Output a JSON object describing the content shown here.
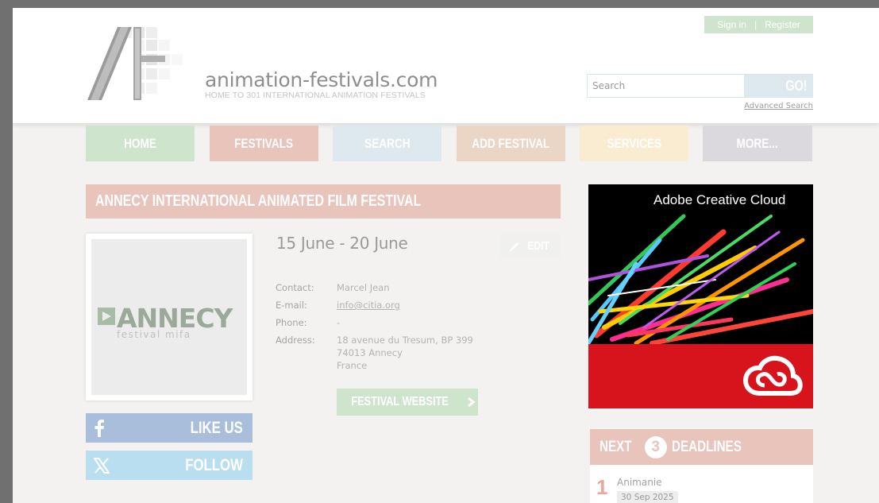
{
  "header": {
    "site_name": "animation-festivals.com",
    "tagline": "HOME TO 301 INTERNATIONAL ANIMATION FESTIVALS",
    "sign_in": "Sign in",
    "separator": "|",
    "register": "Register",
    "search_placeholder": "Search",
    "search_button": "GO!",
    "advanced_search": "Advanced Search"
  },
  "nav": [
    {
      "label": "HOME",
      "color": "#cfe4cd"
    },
    {
      "label": "FESTIVALS",
      "color": "#e8c4bb"
    },
    {
      "label": "SEARCH",
      "color": "#dde9ee"
    },
    {
      "label": "ADD FESTIVAL",
      "color": "#ebd5c4"
    },
    {
      "label": "SERVICES",
      "color": "#faecd1"
    },
    {
      "label": "MORE...",
      "color": "#dcd9de"
    }
  ],
  "festival": {
    "title": "ANNECY INTERNATIONAL ANIMATED FILM FESTIVAL",
    "logo_text": "ANNECY",
    "logo_subtext": "festival mifa",
    "dates": "15 June - 20 June",
    "edit_label": "EDIT",
    "contact_label": "Contact:",
    "contact_value": "Marcel Jean",
    "email_label": "E-mail:",
    "email_value": "info@citia.org",
    "phone_label": "Phone:",
    "phone_value": "-",
    "address_label": "Address:",
    "address_line1": "18 avenue du Tresum, BP 399",
    "address_line2": "74013 Annecy",
    "address_line3": "France",
    "website_label": "FESTIVAL WEBSITE"
  },
  "social": {
    "facebook_label": "LIKE US",
    "x_label": "FOLLOW"
  },
  "ad": {
    "title": "Adobe Creative Cloud",
    "brand_color": "#d7141c"
  },
  "deadlines": {
    "prefix": "NEXT",
    "count": "3",
    "suffix": "DEADLINES",
    "items": [
      {
        "rank": "1",
        "name": "Animanie",
        "date": "30 Sep 2025"
      }
    ]
  }
}
